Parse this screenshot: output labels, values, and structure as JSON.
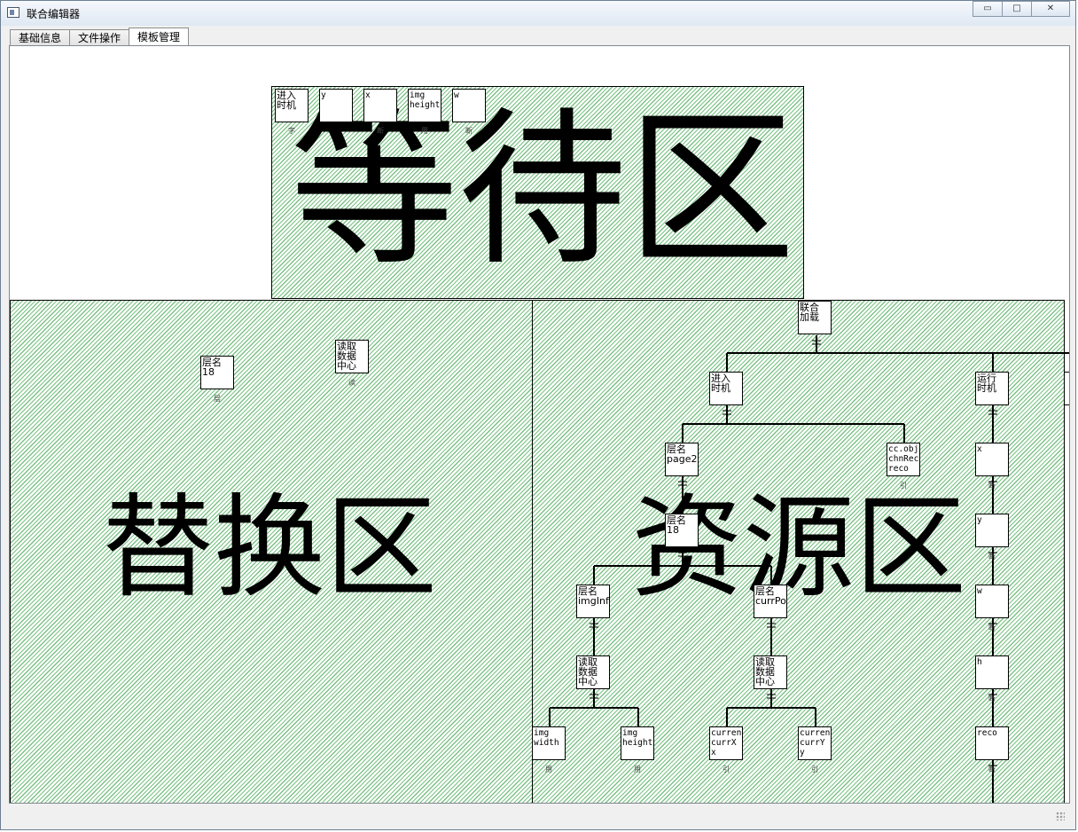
{
  "window": {
    "title": "联合编辑器",
    "minimize": "▭",
    "maximize": "□",
    "close": "✕"
  },
  "tabs": [
    "基础信息",
    "文件操作",
    "模板管理"
  ],
  "active_tab": 2,
  "zones": {
    "waiting": "等待区",
    "replace": "替换区",
    "resource": "资源区"
  },
  "waiting_nodes": [
    {
      "text": "进入\n时机",
      "cap": "字"
    },
    {
      "text": "y",
      "cap": ""
    },
    {
      "text": "x",
      "cap": "断"
    },
    {
      "text": "img\nheight",
      "cap": "用"
    },
    {
      "text": "w",
      "cap": "断"
    }
  ],
  "replace_nodes": [
    {
      "text": "层名\n18",
      "cap": "层"
    },
    {
      "text": "读取\n数据\n中心",
      "cap": "读"
    }
  ],
  "resource_nodes": {
    "root": {
      "text": "联合\n加载"
    },
    "enter": {
      "text": "进入\n时机"
    },
    "run": {
      "text": "运行\n时机"
    },
    "layer_page2": {
      "text": "层名\npage2"
    },
    "ccobj": {
      "text": "cc.obj\nchnReco\nreco",
      "cap": "引"
    },
    "layer18": {
      "text": "层名\n18"
    },
    "layer_imginfo": {
      "text": "层名\nimgInfo"
    },
    "layer_currpos": {
      "text": "层名\ncurrPos"
    },
    "read1": {
      "text": "读取\n数据\n中心"
    },
    "read2": {
      "text": "读取\n数据\n中心"
    },
    "img_width": {
      "text": "img\nwidth",
      "cap": "用"
    },
    "img_height": {
      "text": "img\nheight",
      "cap": "用"
    },
    "curr_x": {
      "text": "curren\ncurrX\nx",
      "cap": "引"
    },
    "curr_y": {
      "text": "curren\ncurrY\ny",
      "cap": "引"
    },
    "x": {
      "text": "x",
      "cap": "断"
    },
    "y": {
      "text": "y",
      "cap": "断"
    },
    "w": {
      "text": "w",
      "cap": "断"
    },
    "h": {
      "text": "h",
      "cap": "断"
    },
    "reco": {
      "text": "reco",
      "cap": "断"
    }
  }
}
